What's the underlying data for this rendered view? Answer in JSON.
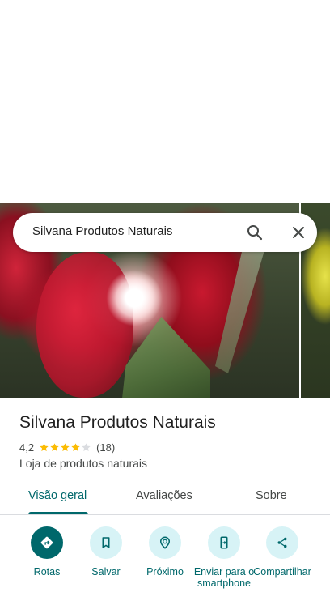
{
  "search": {
    "query": "Silvana Produtos Naturais"
  },
  "place": {
    "name": "Silvana Produtos Naturais",
    "rating": "4,2",
    "stars": 4.2,
    "reviews_count": "(18)",
    "category": "Loja de produtos naturais"
  },
  "tabs": [
    {
      "label": "Visão geral",
      "active": true
    },
    {
      "label": "Avaliações",
      "active": false
    },
    {
      "label": "Sobre",
      "active": false
    }
  ],
  "actions": [
    {
      "label": "Rotas",
      "icon": "directions-icon"
    },
    {
      "label": "Salvar",
      "icon": "bookmark-icon"
    },
    {
      "label": "Próximo",
      "icon": "nearby-icon"
    },
    {
      "label": "Enviar para o smartphone",
      "icon": "send-to-phone-icon"
    },
    {
      "label": "Compartilhar",
      "icon": "share-icon"
    }
  ],
  "colors": {
    "accent": "#00686b",
    "action_bg": "#d7f3f6",
    "star": "#fbbc04",
    "star_empty": "#dadce0"
  }
}
